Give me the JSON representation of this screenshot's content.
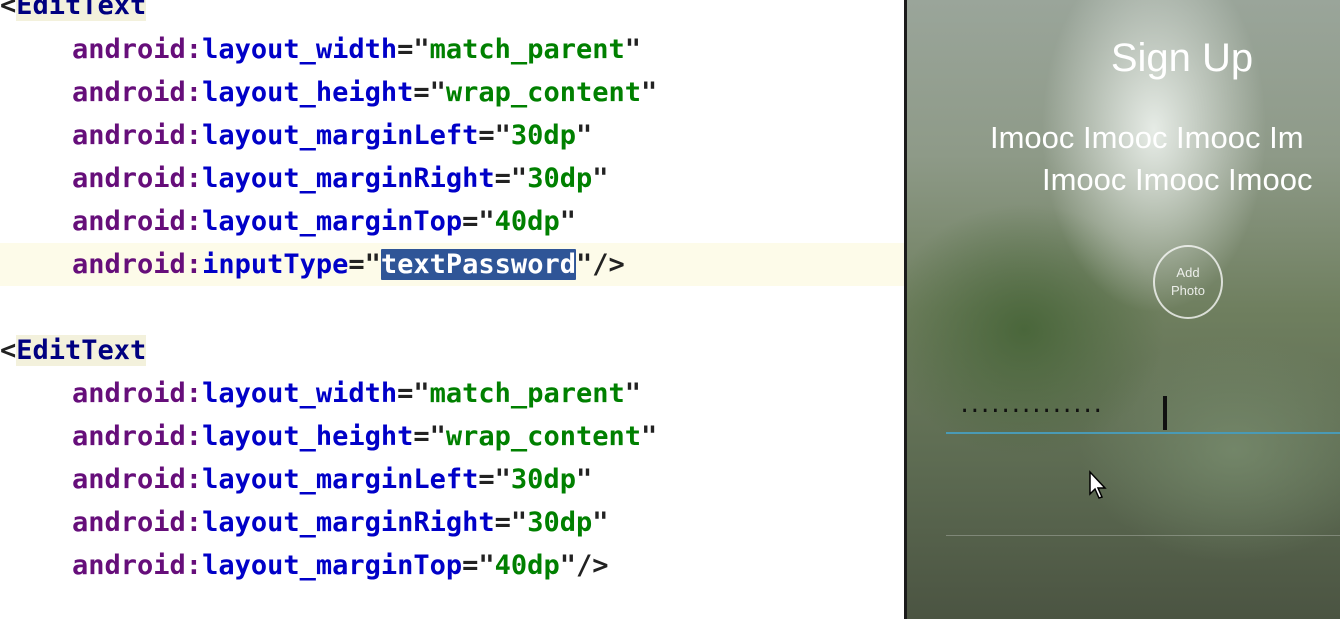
{
  "editor": {
    "block1": {
      "open": "<",
      "tag": "EditText",
      "attrs": [
        {
          "ns": "android",
          "colon": ":",
          "name": "layout_width",
          "eq": "=\"",
          "value": "match_parent",
          "close": "\""
        },
        {
          "ns": "android",
          "colon": ":",
          "name": "layout_height",
          "eq": "=\"",
          "value": "wrap_content",
          "close": "\""
        },
        {
          "ns": "android",
          "colon": ":",
          "name": "layout_marginLeft",
          "eq": "=\"",
          "value": "30dp",
          "close": "\""
        },
        {
          "ns": "android",
          "colon": ":",
          "name": "layout_marginRight",
          "eq": "=\"",
          "value": "30dp",
          "close": "\""
        },
        {
          "ns": "android",
          "colon": ":",
          "name": "layout_marginTop",
          "eq": "=\"",
          "value": "40dp",
          "close": "\""
        },
        {
          "ns": "android",
          "colon": ":",
          "name": "inputType",
          "eq": "=\"",
          "value": "textPassword",
          "close": "\"/>"
        }
      ]
    },
    "block2": {
      "open": "<",
      "tag": "EditText",
      "attrs": [
        {
          "ns": "android",
          "colon": ":",
          "name": "layout_width",
          "eq": "=\"",
          "value": "match_parent",
          "close": "\""
        },
        {
          "ns": "android",
          "colon": ":",
          "name": "layout_height",
          "eq": "=\"",
          "value": "wrap_content",
          "close": "\""
        },
        {
          "ns": "android",
          "colon": ":",
          "name": "layout_marginLeft",
          "eq": "=\"",
          "value": "30dp",
          "close": "\""
        },
        {
          "ns": "android",
          "colon": ":",
          "name": "layout_marginRight",
          "eq": "=\"",
          "value": "30dp",
          "close": "\""
        },
        {
          "ns": "android",
          "colon": ":",
          "name": "layout_marginTop",
          "eq": "=\"",
          "value": "40dp",
          "close": "\"/>"
        }
      ]
    }
  },
  "preview": {
    "title": "Sign Up",
    "line1": "Imooc Imooc Imooc Im",
    "line2": "Imooc Imooc Imooc",
    "add_photo": {
      "line1": "Add",
      "line2": "Photo"
    },
    "password_dots": "··············",
    "colors": {
      "underline": "#4a9ab5",
      "selection": "#2f5597"
    }
  }
}
